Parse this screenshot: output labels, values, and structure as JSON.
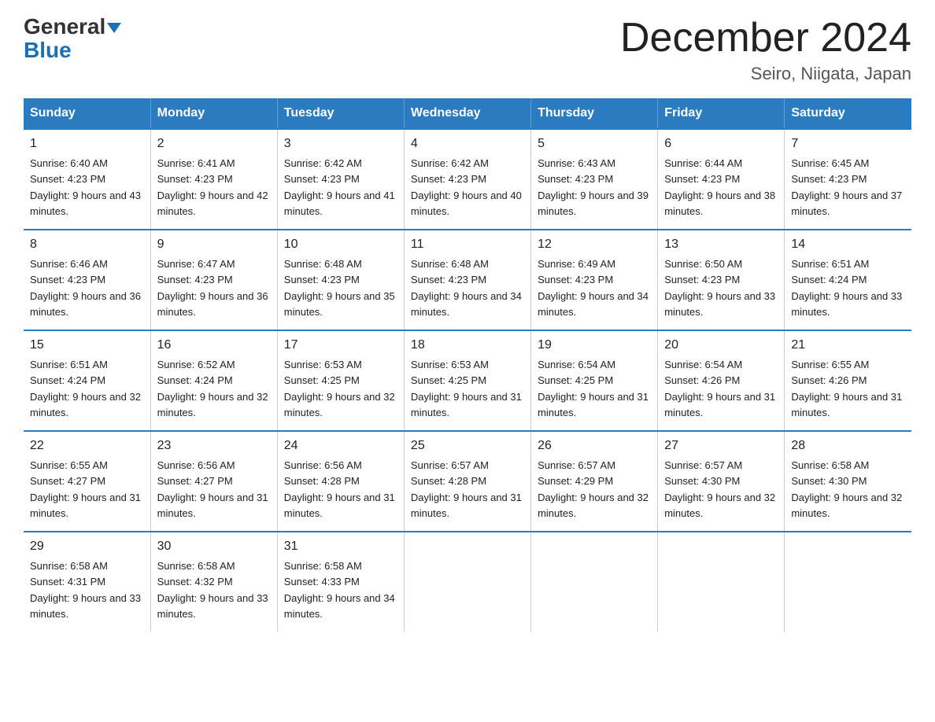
{
  "header": {
    "logo_general": "General",
    "logo_blue": "Blue",
    "title": "December 2024",
    "subtitle": "Seiro, Niigata, Japan"
  },
  "days_of_week": [
    "Sunday",
    "Monday",
    "Tuesday",
    "Wednesday",
    "Thursday",
    "Friday",
    "Saturday"
  ],
  "weeks": [
    [
      {
        "day": "1",
        "sunrise": "Sunrise: 6:40 AM",
        "sunset": "Sunset: 4:23 PM",
        "daylight": "Daylight: 9 hours and 43 minutes."
      },
      {
        "day": "2",
        "sunrise": "Sunrise: 6:41 AM",
        "sunset": "Sunset: 4:23 PM",
        "daylight": "Daylight: 9 hours and 42 minutes."
      },
      {
        "day": "3",
        "sunrise": "Sunrise: 6:42 AM",
        "sunset": "Sunset: 4:23 PM",
        "daylight": "Daylight: 9 hours and 41 minutes."
      },
      {
        "day": "4",
        "sunrise": "Sunrise: 6:42 AM",
        "sunset": "Sunset: 4:23 PM",
        "daylight": "Daylight: 9 hours and 40 minutes."
      },
      {
        "day": "5",
        "sunrise": "Sunrise: 6:43 AM",
        "sunset": "Sunset: 4:23 PM",
        "daylight": "Daylight: 9 hours and 39 minutes."
      },
      {
        "day": "6",
        "sunrise": "Sunrise: 6:44 AM",
        "sunset": "Sunset: 4:23 PM",
        "daylight": "Daylight: 9 hours and 38 minutes."
      },
      {
        "day": "7",
        "sunrise": "Sunrise: 6:45 AM",
        "sunset": "Sunset: 4:23 PM",
        "daylight": "Daylight: 9 hours and 37 minutes."
      }
    ],
    [
      {
        "day": "8",
        "sunrise": "Sunrise: 6:46 AM",
        "sunset": "Sunset: 4:23 PM",
        "daylight": "Daylight: 9 hours and 36 minutes."
      },
      {
        "day": "9",
        "sunrise": "Sunrise: 6:47 AM",
        "sunset": "Sunset: 4:23 PM",
        "daylight": "Daylight: 9 hours and 36 minutes."
      },
      {
        "day": "10",
        "sunrise": "Sunrise: 6:48 AM",
        "sunset": "Sunset: 4:23 PM",
        "daylight": "Daylight: 9 hours and 35 minutes."
      },
      {
        "day": "11",
        "sunrise": "Sunrise: 6:48 AM",
        "sunset": "Sunset: 4:23 PM",
        "daylight": "Daylight: 9 hours and 34 minutes."
      },
      {
        "day": "12",
        "sunrise": "Sunrise: 6:49 AM",
        "sunset": "Sunset: 4:23 PM",
        "daylight": "Daylight: 9 hours and 34 minutes."
      },
      {
        "day": "13",
        "sunrise": "Sunrise: 6:50 AM",
        "sunset": "Sunset: 4:23 PM",
        "daylight": "Daylight: 9 hours and 33 minutes."
      },
      {
        "day": "14",
        "sunrise": "Sunrise: 6:51 AM",
        "sunset": "Sunset: 4:24 PM",
        "daylight": "Daylight: 9 hours and 33 minutes."
      }
    ],
    [
      {
        "day": "15",
        "sunrise": "Sunrise: 6:51 AM",
        "sunset": "Sunset: 4:24 PM",
        "daylight": "Daylight: 9 hours and 32 minutes."
      },
      {
        "day": "16",
        "sunrise": "Sunrise: 6:52 AM",
        "sunset": "Sunset: 4:24 PM",
        "daylight": "Daylight: 9 hours and 32 minutes."
      },
      {
        "day": "17",
        "sunrise": "Sunrise: 6:53 AM",
        "sunset": "Sunset: 4:25 PM",
        "daylight": "Daylight: 9 hours and 32 minutes."
      },
      {
        "day": "18",
        "sunrise": "Sunrise: 6:53 AM",
        "sunset": "Sunset: 4:25 PM",
        "daylight": "Daylight: 9 hours and 31 minutes."
      },
      {
        "day": "19",
        "sunrise": "Sunrise: 6:54 AM",
        "sunset": "Sunset: 4:25 PM",
        "daylight": "Daylight: 9 hours and 31 minutes."
      },
      {
        "day": "20",
        "sunrise": "Sunrise: 6:54 AM",
        "sunset": "Sunset: 4:26 PM",
        "daylight": "Daylight: 9 hours and 31 minutes."
      },
      {
        "day": "21",
        "sunrise": "Sunrise: 6:55 AM",
        "sunset": "Sunset: 4:26 PM",
        "daylight": "Daylight: 9 hours and 31 minutes."
      }
    ],
    [
      {
        "day": "22",
        "sunrise": "Sunrise: 6:55 AM",
        "sunset": "Sunset: 4:27 PM",
        "daylight": "Daylight: 9 hours and 31 minutes."
      },
      {
        "day": "23",
        "sunrise": "Sunrise: 6:56 AM",
        "sunset": "Sunset: 4:27 PM",
        "daylight": "Daylight: 9 hours and 31 minutes."
      },
      {
        "day": "24",
        "sunrise": "Sunrise: 6:56 AM",
        "sunset": "Sunset: 4:28 PM",
        "daylight": "Daylight: 9 hours and 31 minutes."
      },
      {
        "day": "25",
        "sunrise": "Sunrise: 6:57 AM",
        "sunset": "Sunset: 4:28 PM",
        "daylight": "Daylight: 9 hours and 31 minutes."
      },
      {
        "day": "26",
        "sunrise": "Sunrise: 6:57 AM",
        "sunset": "Sunset: 4:29 PM",
        "daylight": "Daylight: 9 hours and 32 minutes."
      },
      {
        "day": "27",
        "sunrise": "Sunrise: 6:57 AM",
        "sunset": "Sunset: 4:30 PM",
        "daylight": "Daylight: 9 hours and 32 minutes."
      },
      {
        "day": "28",
        "sunrise": "Sunrise: 6:58 AM",
        "sunset": "Sunset: 4:30 PM",
        "daylight": "Daylight: 9 hours and 32 minutes."
      }
    ],
    [
      {
        "day": "29",
        "sunrise": "Sunrise: 6:58 AM",
        "sunset": "Sunset: 4:31 PM",
        "daylight": "Daylight: 9 hours and 33 minutes."
      },
      {
        "day": "30",
        "sunrise": "Sunrise: 6:58 AM",
        "sunset": "Sunset: 4:32 PM",
        "daylight": "Daylight: 9 hours and 33 minutes."
      },
      {
        "day": "31",
        "sunrise": "Sunrise: 6:58 AM",
        "sunset": "Sunset: 4:33 PM",
        "daylight": "Daylight: 9 hours and 34 minutes."
      },
      {
        "day": "",
        "sunrise": "",
        "sunset": "",
        "daylight": ""
      },
      {
        "day": "",
        "sunrise": "",
        "sunset": "",
        "daylight": ""
      },
      {
        "day": "",
        "sunrise": "",
        "sunset": "",
        "daylight": ""
      },
      {
        "day": "",
        "sunrise": "",
        "sunset": "",
        "daylight": ""
      }
    ]
  ]
}
